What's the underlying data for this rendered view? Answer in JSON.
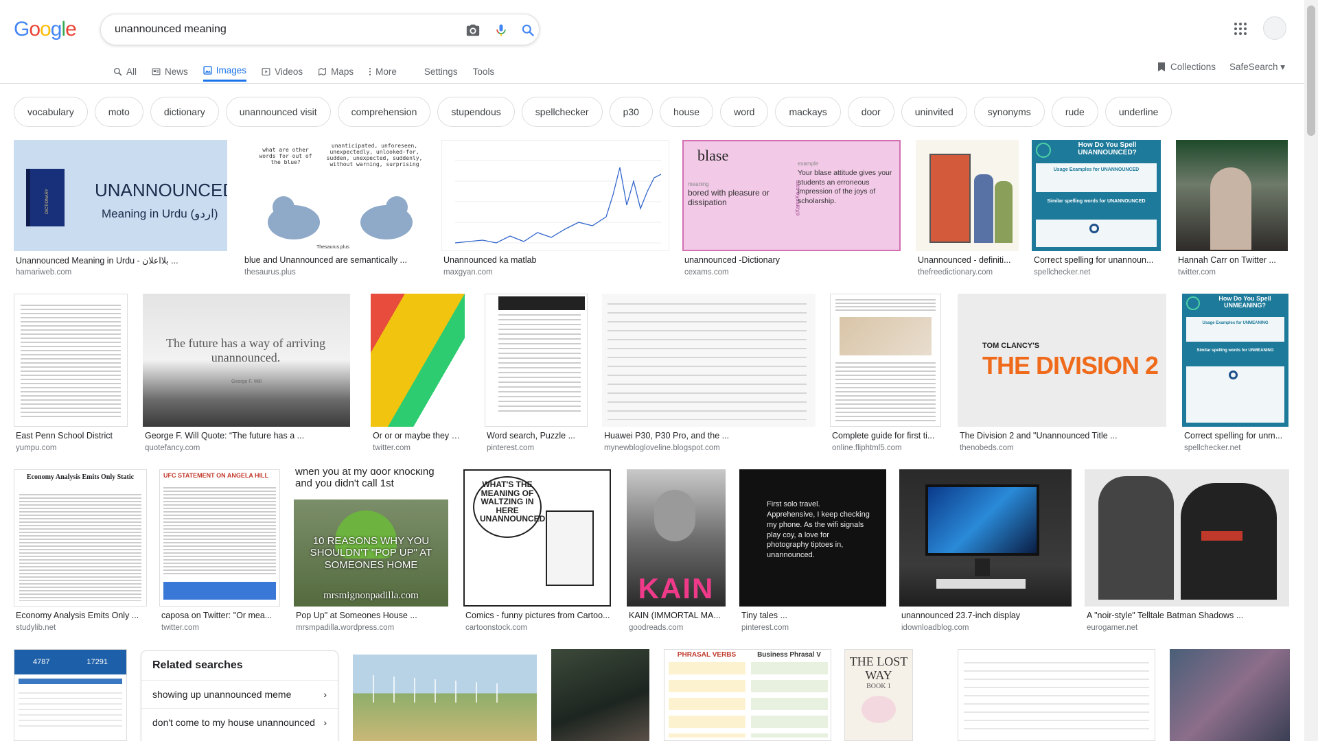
{
  "logo": "Google",
  "search": {
    "query": "unannounced meaning"
  },
  "tabs": [
    {
      "label": "All",
      "icon": "search-icon"
    },
    {
      "label": "News",
      "icon": "news-icon"
    },
    {
      "label": "Images",
      "icon": "image-icon",
      "active": true
    },
    {
      "label": "Videos",
      "icon": "video-icon"
    },
    {
      "label": "Maps",
      "icon": "map-icon"
    },
    {
      "label": "More",
      "icon": "more-icon"
    }
  ],
  "tools": {
    "settings": "Settings",
    "tools": "Tools"
  },
  "right": {
    "collections": "Collections",
    "safesearch": "SafeSearch"
  },
  "chips": [
    "vocabulary",
    "moto",
    "dictionary",
    "unannounced visit",
    "comprehension",
    "stupendous",
    "spellchecker",
    "p30",
    "house",
    "word",
    "mackays",
    "door",
    "uninvited",
    "synonyms",
    "rude",
    "underline"
  ],
  "results": [
    {
      "caption": "Unannounced Meaning in Urdu - بلااعلان ...",
      "source": "hamariweb.com"
    },
    {
      "caption": "blue and Unannounced are semantically ...",
      "source": "thesaurus.plus"
    },
    {
      "caption": "Unannounced ka matlab",
      "source": "maxgyan.com"
    },
    {
      "caption": "unannounced -Dictionary",
      "source": "cexams.com"
    },
    {
      "caption": "Unannounced - definiti...",
      "source": "thefreedictionary.com"
    },
    {
      "caption": "Correct spelling for unannoun...",
      "source": "spellchecker.net"
    },
    {
      "caption": "Hannah Carr on Twitter ...",
      "source": "twitter.com"
    },
    {
      "caption": "East Penn School District",
      "source": "yumpu.com"
    },
    {
      "caption": "George F. Will Quote: “The future has a ...",
      "source": "quotefancy.com"
    },
    {
      "caption": "Or or or maybe they em...",
      "source": "twitter.com"
    },
    {
      "caption": "Word search, Puzzle ...",
      "source": "pinterest.com"
    },
    {
      "caption": "Huawei P30, P30 Pro, and the ...",
      "source": "mynewblogloveline.blogspot.com"
    },
    {
      "caption": "Complete guide for first ti...",
      "source": "online.fliphtml5.com"
    },
    {
      "caption": "The Division 2 and \"Unannounced Title ...",
      "source": "thenobeds.com"
    },
    {
      "caption": "Correct spelling for unm...",
      "source": "spellchecker.net"
    },
    {
      "caption": "Economy Analysis Emits Only ...",
      "source": "studylib.net"
    },
    {
      "caption": "caposa on Twitter: \"Or mea...",
      "source": "twitter.com"
    },
    {
      "caption": "Pop Up\" at Someones House ...",
      "source": "mrsmpadilla.wordpress.com"
    },
    {
      "caption": "Comics - funny pictures from Cartoo...",
      "source": "cartoonstock.com"
    },
    {
      "caption": "KAIN (IMMORTAL MA...",
      "source": "goodreads.com"
    },
    {
      "caption": "Tiny tales ...",
      "source": "pinterest.com"
    },
    {
      "caption": "unannounced 23.7-inch display",
      "source": "idownloadblog.com"
    },
    {
      "caption": "A \"noir-style\" Telltale Batman Shadows ...",
      "source": "eurogamer.net"
    }
  ],
  "thumbs": {
    "urdu": {
      "title": "UNANNOUNCED",
      "sub": "Meaning in Urdu (اردو)",
      "book": "DICTIONARY"
    },
    "pigeons": {
      "q": "what are other words for out of the blue?",
      "a": "unanticipated, unforeseen, unexpectedly, unlooked-for, sudden, unexpected, suddenly, without warning, surprising",
      "brand": "Thesaurus.plus"
    },
    "blase": {
      "word": "blase",
      "meaning_label": "meaning",
      "meaning": "bored with pleasure or dissipation",
      "example_label": "example",
      "example": "Your blase attitude gives your students an erroneous impression of the joys of scholarship.",
      "brand": "eXamsKe.com"
    },
    "spell1": {
      "title": "How Do You Spell UNANNOUNCED?",
      "s1": "Usage Examples for UNANNOUNCED",
      "s2": "Similar spelling words for UNANNOUNCED"
    },
    "quote": {
      "text": "The future has a way of arriving unannounced.",
      "author": "George F. Will"
    },
    "division": {
      "brand": "TOM CLANCY'S",
      "title": "THE DIVISION 2"
    },
    "spell2": {
      "title": "How Do You Spell UNMEANING?",
      "s1": "Usage Examples for UNMEANING",
      "s2": "Similar spelling words for UNMEANING"
    },
    "ufc": "UFC STATEMENT ON ANGELA HILL",
    "kermit": {
      "top": "when you at my door knocking and you didn't call 1st",
      "mid": "10 REASONS WHY YOU SHOULDN'T \"POP UP\" AT SOMEONES HOME",
      "brand": "mrsmignonpadilla.com"
    },
    "comic": "WHAT'S THE MEANING OF WALTZING IN HERE UNANNOUNCED?",
    "kain": "KAIN",
    "travel": "First solo travel. Apprehensive, I keep checking my phone. As the wifi signals play coy, a love for photography tiptoes in, unannounced.",
    "economy": "Economy Analysis Emits Only Static",
    "stats": {
      "a": "4787",
      "b": "17291"
    },
    "lostway": {
      "title": "THE LOST WAY",
      "book": "BOOK 1"
    },
    "phrasal": {
      "t1": "PHRASAL VERBS",
      "t2": "Business Phrasal V"
    }
  },
  "related": {
    "title": "Related searches",
    "items": [
      "showing up unannounced meme",
      "don't come to my house unannounced"
    ]
  },
  "colors": {
    "accent": "#1a73e8",
    "blue": "#4285F4",
    "red": "#EA4335",
    "yellow": "#FBBC05",
    "green": "#34A853"
  }
}
